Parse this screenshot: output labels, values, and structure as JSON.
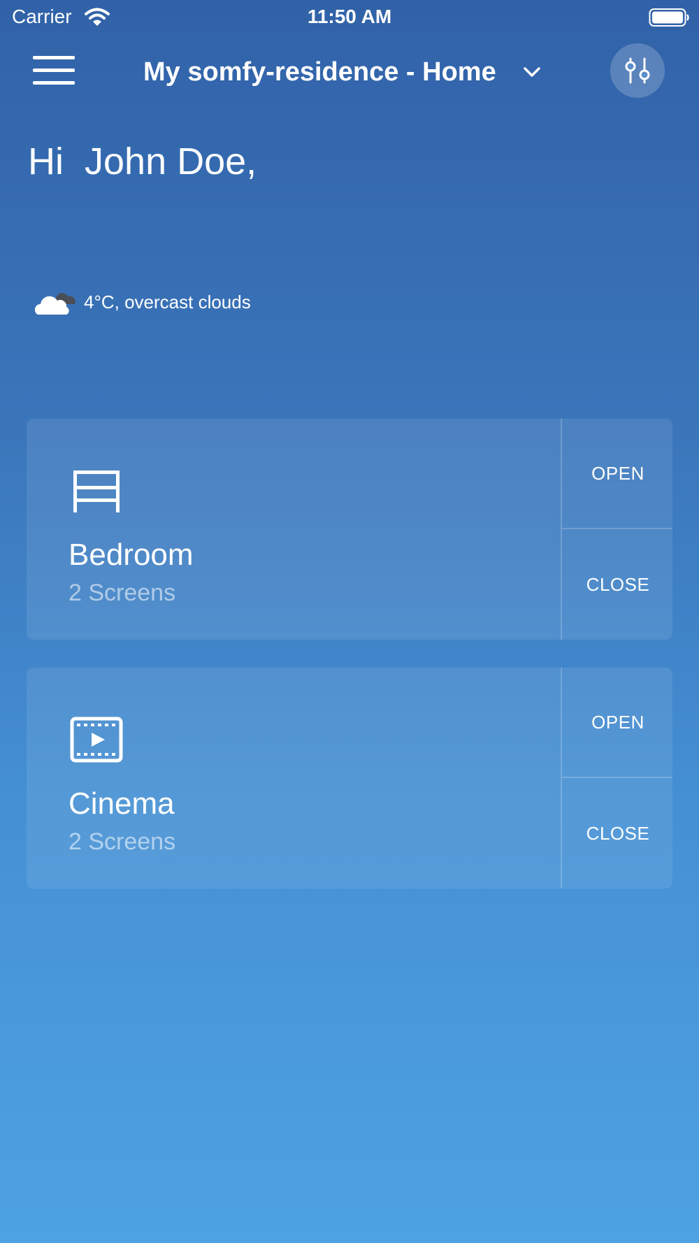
{
  "status_bar": {
    "carrier": "Carrier",
    "time": "11:50 AM",
    "icons": [
      "wifi-icon",
      "battery-icon"
    ]
  },
  "header": {
    "home_title": "My somfy-residence - Home",
    "icons": [
      "menu-icon",
      "chevron-down-icon",
      "filter-sliders-icon"
    ]
  },
  "greeting": "Hi  John Doe,",
  "weather": {
    "icon": "cloud-icon",
    "text": "4°C, overcast clouds"
  },
  "rooms": [
    {
      "name": "Bedroom",
      "subtitle": "2 Screens",
      "icon": "bed-icon",
      "open_label": "OPEN",
      "close_label": "CLOSE"
    },
    {
      "name": "Cinema",
      "subtitle": "2 Screens",
      "icon": "film-icon",
      "open_label": "OPEN",
      "close_label": "CLOSE"
    }
  ],
  "colors": {
    "background_top": "#3162a8",
    "background_bottom": "#4da2e3",
    "text": "#ffffff"
  }
}
